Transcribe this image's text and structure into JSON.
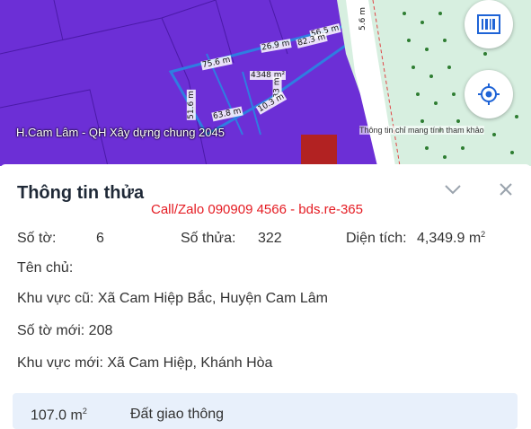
{
  "map": {
    "title": "H.Cam Lâm - QH Xây dựng chung 2045",
    "note": "Thông tin chỉ mang tính tham khảo",
    "dimensions": [
      "5.6 m",
      "56.5 m",
      "82.3 m",
      "26.9 m",
      "75.6 m",
      "4348 m²",
      "33 m",
      "51.6 m",
      "10.3 m",
      "63.8 m"
    ],
    "colors": {
      "plot": "#6c2fd6",
      "selected_plot": "#e7e7f2",
      "outline": "#2f7de1",
      "road": "#ffffff"
    },
    "barcode_icon": "barcode-icon",
    "locate_icon": "crosshair-icon"
  },
  "panel": {
    "title": "Thông tin thửa",
    "watermark": "Call/Zalo 090909 4566 - bds.re-365",
    "chevron_icon": "chevron-down-icon",
    "close_icon": "close-icon",
    "so_to_label": "Số tờ:",
    "so_to_value": "6",
    "so_thua_label": "Số thửa:",
    "so_thua_value": "322",
    "dien_tich_label": "Diện tích:",
    "dien_tich_value": "4,349.9 m",
    "dien_tich_unit_sup": "2",
    "ten_chu_label": "Tên chủ:",
    "ten_chu_value": "",
    "khu_vuc_cu_label": "Khu vực cũ:",
    "khu_vuc_cu_value": "Xã Cam Hiệp Bắc, Huyện Cam Lâm",
    "so_to_moi_label": "Số tờ mới:",
    "so_to_moi_value": "208",
    "khu_vuc_moi_label": "Khu vực mới:",
    "khu_vuc_moi_value": "Xã Cam Hiệp, Khánh Hòa",
    "land_use": {
      "area": "107.0 m",
      "area_sup": "2",
      "type": "Đất giao thông"
    }
  }
}
